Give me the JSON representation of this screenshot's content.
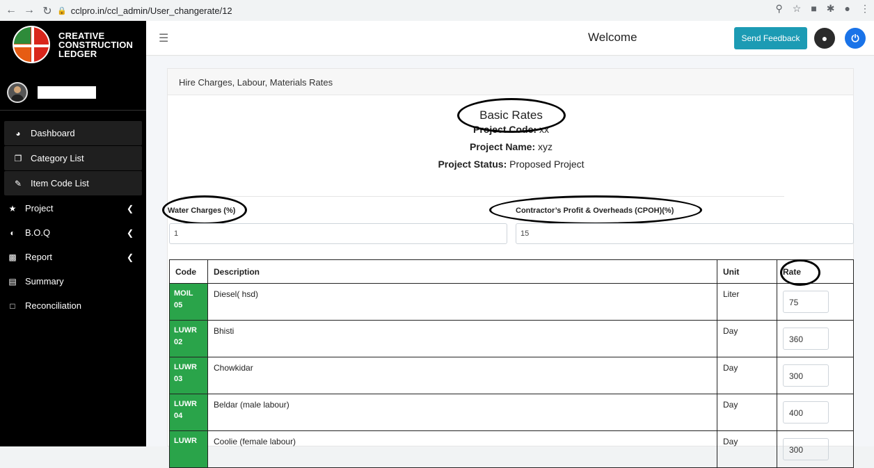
{
  "browser": {
    "url": "cclpro.in/ccl_admin/User_changerate/12"
  },
  "sidebar": {
    "logo_lines": [
      "CREATIVE",
      "CONSTRUCTION",
      "LEDGER"
    ],
    "items": [
      {
        "label": "Dashboard",
        "icon": "dashboard-icon"
      },
      {
        "label": "Category List",
        "icon": "copy-icon"
      },
      {
        "label": "Item Code List",
        "icon": "edit-icon"
      },
      {
        "label": "Project",
        "icon": "star-icon"
      },
      {
        "label": "B.O.Q",
        "icon": "half-circle-icon"
      },
      {
        "label": "Report",
        "icon": "money-icon"
      },
      {
        "label": "Summary",
        "icon": "file-icon"
      },
      {
        "label": "Reconciliation",
        "icon": "note-icon"
      }
    ]
  },
  "topbar": {
    "welcome": "Welcome",
    "feedback_label": "Send Feedback"
  },
  "card": {
    "header": "Hire Charges, Labour, Materials Rates",
    "title": "Basic Rates",
    "project_code_label": "Project Code:",
    "project_code": "xx",
    "project_name_label": "Project Name:",
    "project_name": "xyz",
    "project_status_label": "Project Status:",
    "project_status": "Proposed Project",
    "water_label": "Water Charges (%)",
    "water_value": "1",
    "cpoh_label": "Contractor’s Profit & Overheads (CPOH)(%)",
    "cpoh_value": "15"
  },
  "table": {
    "headers": [
      "Code",
      "Description",
      "Unit",
      "Rate"
    ],
    "rows": [
      {
        "code1": "MOIL",
        "code2": "05",
        "description": "Diesel( hsd)",
        "unit": "Liter",
        "rate": "75"
      },
      {
        "code1": "LUWR",
        "code2": "02",
        "description": "Bhisti",
        "unit": "Day",
        "rate": "360"
      },
      {
        "code1": "LUWR",
        "code2": "03",
        "description": "Chowkidar",
        "unit": "Day",
        "rate": "300"
      },
      {
        "code1": "LUWR",
        "code2": "04",
        "description": "Beldar (male labour)",
        "unit": "Day",
        "rate": "400"
      },
      {
        "code1": "LUWR",
        "code2": "",
        "description": "Coolie (female labour)",
        "unit": "Day",
        "rate": "300"
      }
    ]
  }
}
